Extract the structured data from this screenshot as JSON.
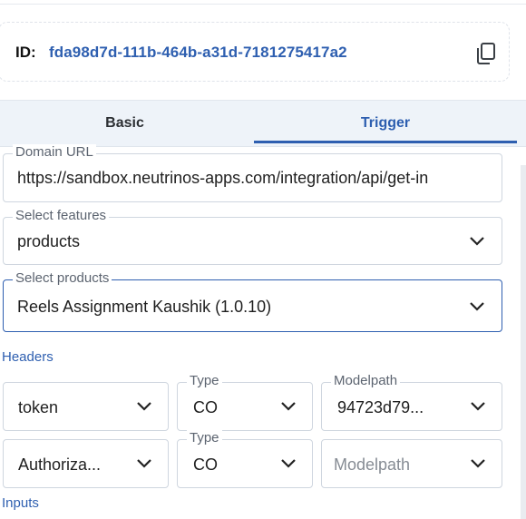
{
  "id_card": {
    "label": "ID:",
    "value": "fda98d7d-111b-464b-a31d-7181275417a2"
  },
  "tabs": [
    {
      "label": "Basic",
      "active": false
    },
    {
      "label": "Trigger",
      "active": true
    }
  ],
  "form": {
    "domain_url": {
      "label": "Domain URL",
      "value": "https://sandbox.neutrinos-apps.com/integration/api/get-in"
    },
    "select_features": {
      "label": "Select features",
      "value": "products"
    },
    "select_products": {
      "label": "Select products",
      "value": "Reels Assignment Kaushik (1.0.10)"
    }
  },
  "headers_section": {
    "title": "Headers",
    "rows": [
      {
        "key": "token",
        "type_label": "Type",
        "type_value": "CO",
        "modelpath_label": "Modelpath",
        "modelpath_value": "94723d79..."
      },
      {
        "key": "Authoriza...",
        "type_label": "Type",
        "type_value": "CO",
        "modelpath_placeholder": "Modelpath"
      }
    ]
  },
  "inputs_section": {
    "title": "Inputs"
  },
  "colors": {
    "accent": "#2e5fb0",
    "tabbar_bg": "#eef3f9",
    "border": "#cfd6df"
  },
  "icons": {
    "copy": "copy-icon",
    "dropdown": "chevron-down-icon"
  }
}
